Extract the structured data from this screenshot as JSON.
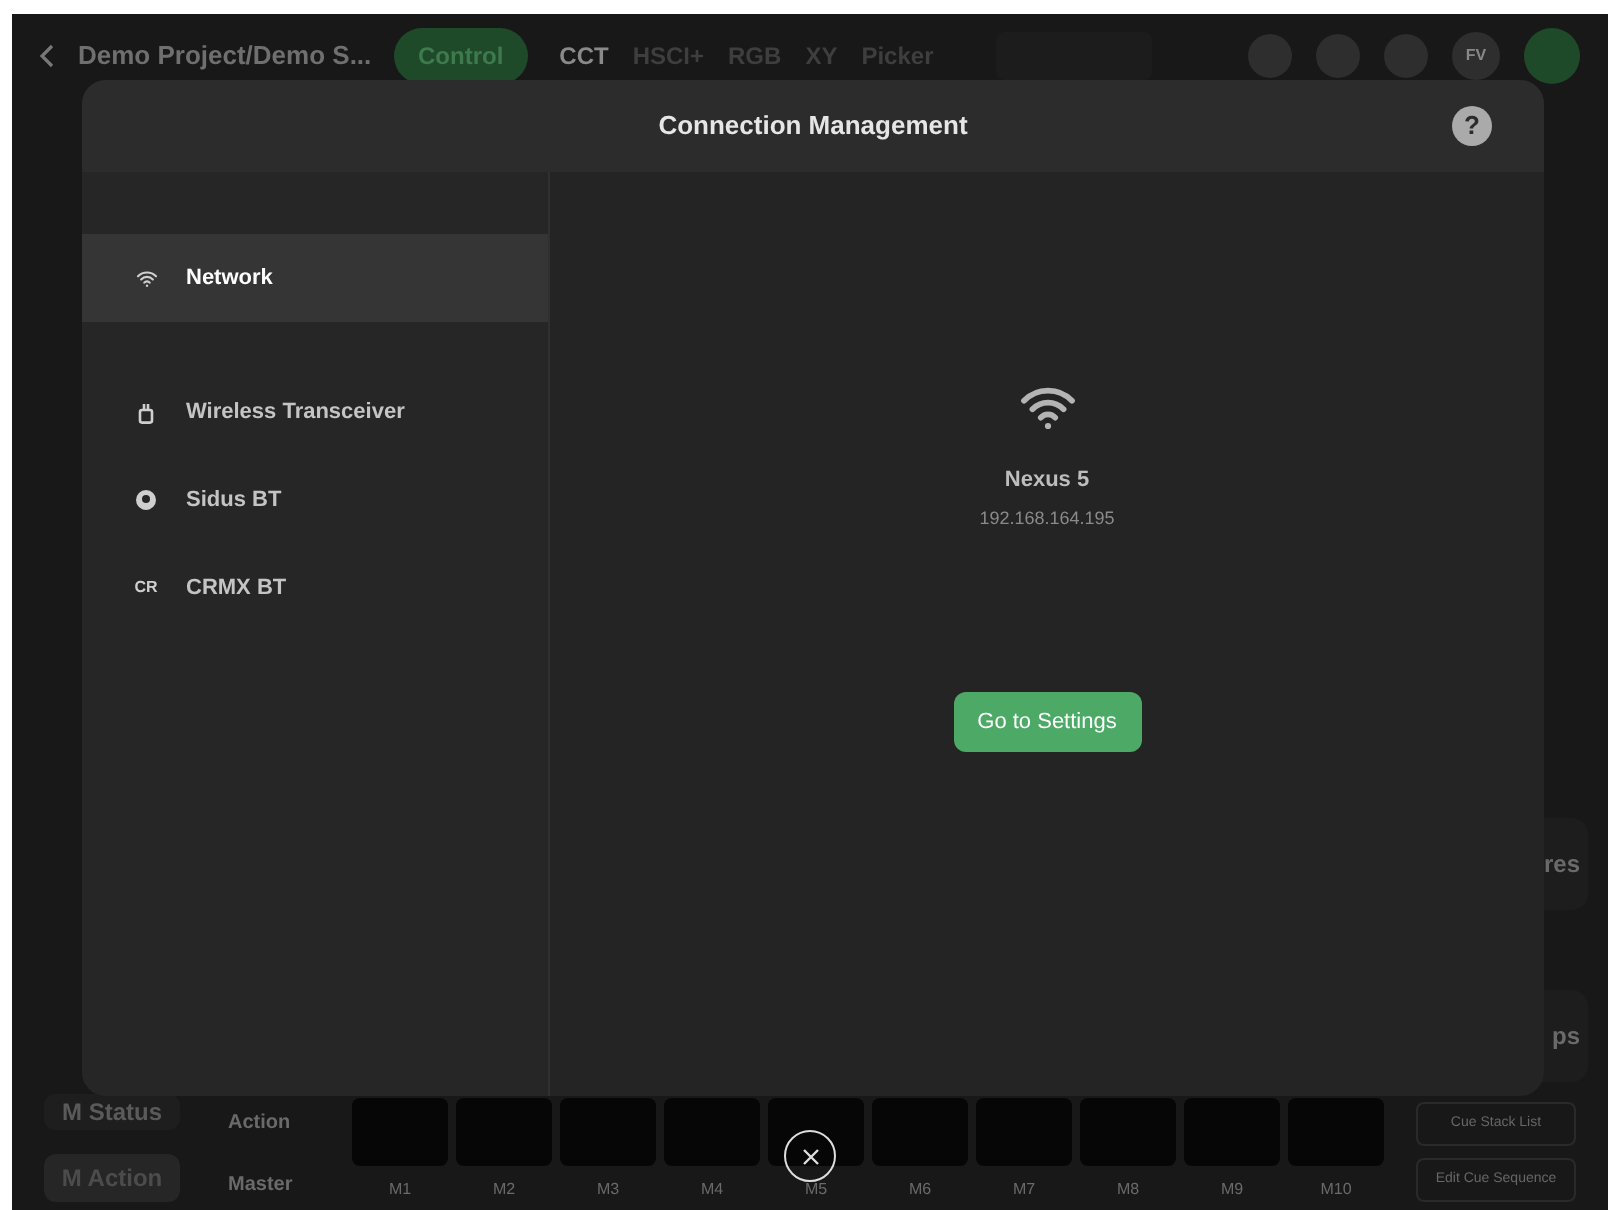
{
  "app": {
    "title": "Demo Project/Demo S...",
    "mode_button": "Control",
    "color_tabs": [
      {
        "label": "CCT",
        "selected": true
      },
      {
        "label": "HSCI+",
        "selected": false
      },
      {
        "label": "RGB",
        "selected": false
      },
      {
        "label": "XY",
        "selected": false
      },
      {
        "label": "Picker",
        "selected": false
      }
    ],
    "avatar": "FV",
    "side_fragments": [
      "res",
      "ps"
    ],
    "status_button": "M Status",
    "action_button": "M Action",
    "row_labels": [
      "Action",
      "Master"
    ],
    "pads": [
      "M1",
      "M2",
      "M3",
      "M4",
      "M5",
      "M6",
      "M7",
      "M8",
      "M9",
      "M10"
    ],
    "right_buttons": [
      "Cue Stack List",
      "Edit Cue Sequence"
    ]
  },
  "dialog": {
    "title": "Connection Management",
    "help": "?",
    "items": [
      {
        "label": "Network",
        "kind": "wifi",
        "selected": true
      },
      {
        "label": "Wireless Transceiver",
        "kind": "transceiver",
        "selected": false
      },
      {
        "label": "Sidus BT",
        "kind": "sidus",
        "selected": false
      },
      {
        "label": "CRMX BT",
        "kind": "crmx",
        "icon_text": "CR",
        "selected": false
      }
    ],
    "device": {
      "name": "Nexus 5",
      "address": "192.168.164.195"
    },
    "action": "Go to Settings"
  }
}
